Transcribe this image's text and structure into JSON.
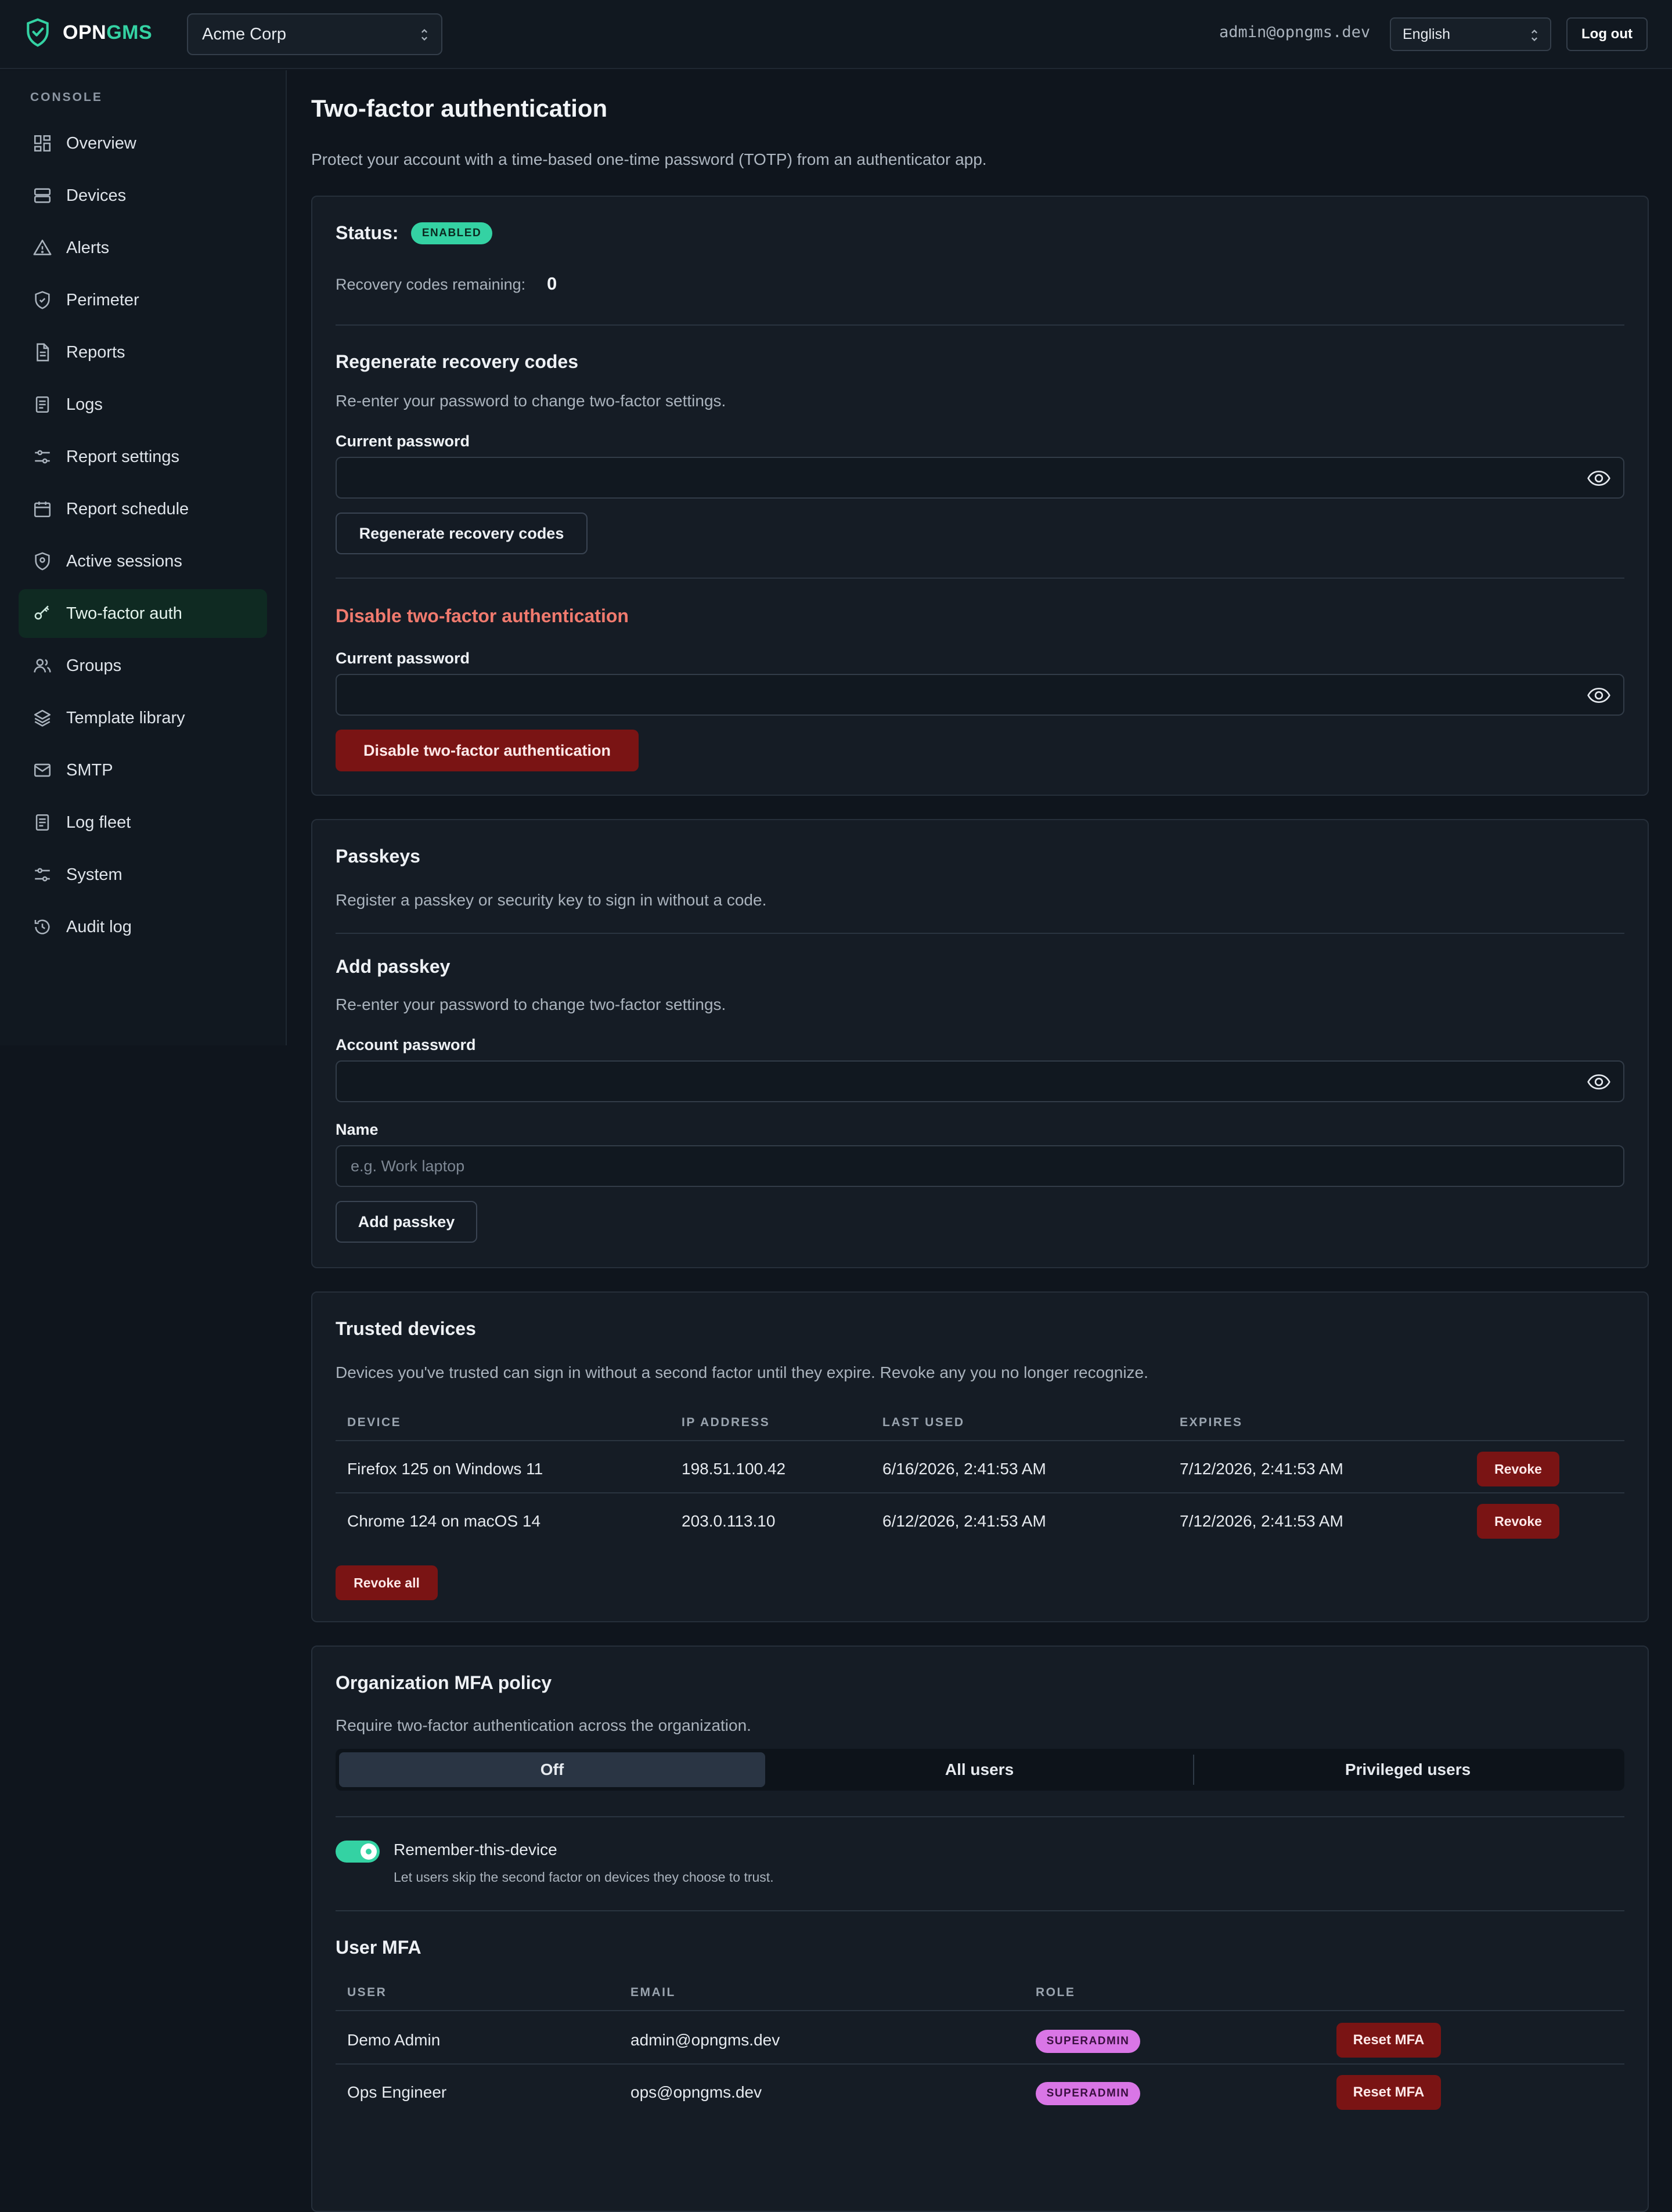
{
  "app": {
    "name_part1": "OPN",
    "name_part2": "GMS"
  },
  "colors": {
    "accent": "#34d2a3",
    "danger": "#7a1414",
    "role_badge": "#d976e6"
  },
  "header": {
    "org": "Acme Corp",
    "user_email": "admin@opngms.dev",
    "language": "English",
    "logout": "Log out"
  },
  "sidebar": {
    "heading": "CONSOLE",
    "items": [
      {
        "label": "Overview",
        "icon": "grid-icon"
      },
      {
        "label": "Devices",
        "icon": "server-icon"
      },
      {
        "label": "Alerts",
        "icon": "warning-icon"
      },
      {
        "label": "Perimeter",
        "icon": "shield-icon"
      },
      {
        "label": "Reports",
        "icon": "document-icon"
      },
      {
        "label": "Logs",
        "icon": "list-icon"
      },
      {
        "label": "Report settings",
        "icon": "sliders-icon"
      },
      {
        "label": "Report schedule",
        "icon": "calendar-icon"
      },
      {
        "label": "Active sessions",
        "icon": "location-shield-icon"
      },
      {
        "label": "Two-factor auth",
        "icon": "key-icon",
        "active": true
      },
      {
        "label": "Groups",
        "icon": "users-icon"
      },
      {
        "label": "Template library",
        "icon": "layers-icon"
      },
      {
        "label": "SMTP",
        "icon": "mail-icon"
      },
      {
        "label": "Log fleet",
        "icon": "list-icon"
      },
      {
        "label": "System",
        "icon": "sliders-icon"
      },
      {
        "label": "Audit log",
        "icon": "history-icon"
      }
    ]
  },
  "page": {
    "title": "Two-factor authentication",
    "description": "Protect your account with a time-based one-time password (TOTP) from an authenticator app."
  },
  "totp": {
    "status_label": "Status:",
    "status_badge": "ENABLED",
    "recovery_label": "Recovery codes remaining:",
    "recovery_count": "0",
    "regen_title": "Regenerate recovery codes",
    "regen_desc": "Re-enter your password to change two-factor settings.",
    "regen_password_label": "Current password",
    "regen_button": "Regenerate recovery codes",
    "disable_title": "Disable two-factor authentication",
    "disable_password_label": "Current password",
    "disable_button": "Disable two-factor authentication"
  },
  "passkeys": {
    "title": "Passkeys",
    "desc": "Register a passkey or security key to sign in without a code.",
    "add_title": "Add passkey",
    "add_desc": "Re-enter your password to change two-factor settings.",
    "password_label": "Account password",
    "name_label": "Name",
    "name_placeholder": "e.g. Work laptop",
    "add_button": "Add passkey"
  },
  "trusted": {
    "title": "Trusted devices",
    "desc": "Devices you've trusted can sign in without a second factor until they expire. Revoke any you no longer recognize.",
    "columns": [
      "DEVICE",
      "IP ADDRESS",
      "LAST USED",
      "EXPIRES"
    ],
    "rows": [
      {
        "device": "Firefox 125 on Windows 11",
        "ip": "198.51.100.42",
        "last_used": "6/16/2026, 2:41:53 AM",
        "expires": "7/12/2026, 2:41:53 AM",
        "action": "Revoke"
      },
      {
        "device": "Chrome 124 on macOS 14",
        "ip": "203.0.113.10",
        "last_used": "6/12/2026, 2:41:53 AM",
        "expires": "7/12/2026, 2:41:53 AM",
        "action": "Revoke"
      }
    ],
    "revoke_all": "Revoke all"
  },
  "policy": {
    "title": "Organization MFA policy",
    "desc": "Require two-factor authentication across the organization.",
    "options": [
      "Off",
      "All users",
      "Privileged users"
    ],
    "selected": "Off",
    "remember_label": "Remember-this-device",
    "remember_hint": "Let users skip the second factor on devices they choose to trust.",
    "remember_on": true,
    "user_mfa_title": "User MFA",
    "columns": [
      "USER",
      "EMAIL",
      "ROLE"
    ],
    "users": [
      {
        "name": "Demo Admin",
        "email": "admin@opngms.dev",
        "role": "SUPERADMIN",
        "action": "Reset MFA"
      },
      {
        "name": "Ops Engineer",
        "email": "ops@opngms.dev",
        "role": "SUPERADMIN",
        "action": "Reset MFA"
      }
    ]
  }
}
